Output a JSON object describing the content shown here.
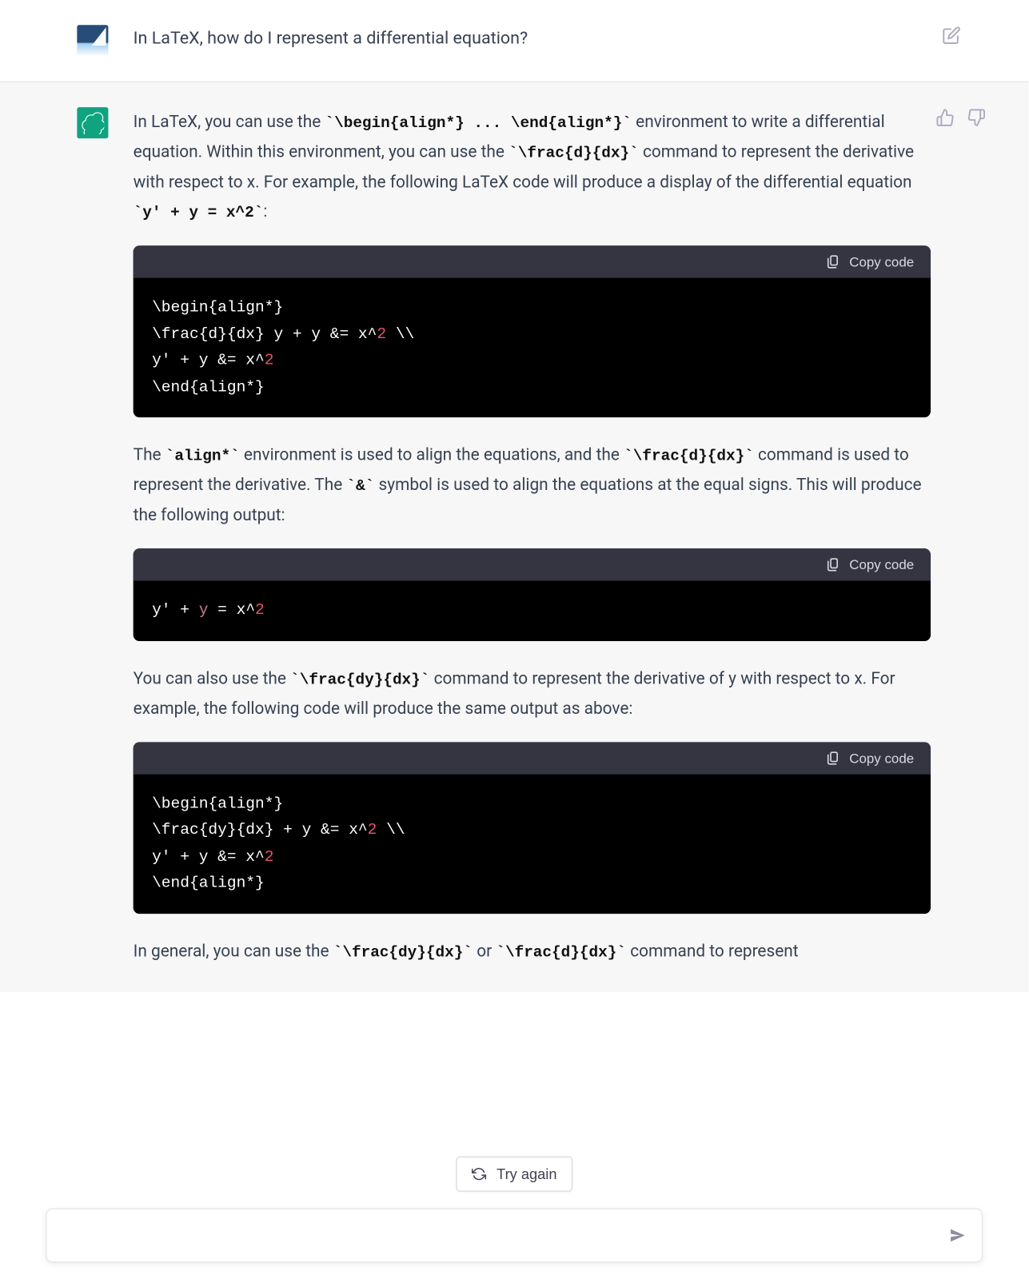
{
  "user": {
    "question": "In LaTeX, how do I represent a differential equation?"
  },
  "assistant": {
    "p1_a": "In LaTeX, you can use the ",
    "p1_code1": "`\\begin{align*} ... \\end{align*}`",
    "p1_b": " environment to write a differential equation. Within this environment, you can use the ",
    "p1_code2": "`\\frac{d}{dx}`",
    "p1_c": " command to represent the derivative with respect to x. For example, the following LaTeX code will produce a display of the differential equation ",
    "p1_code3": "`y' + y = x^2`",
    "p1_d": ":",
    "p2_a": "The ",
    "p2_code1": "`align*`",
    "p2_b": " environment is used to align the equations, and the ",
    "p2_code2": "`\\frac{d}{dx}`",
    "p2_c": " command is used to represent the derivative. The ",
    "p2_code3": "`&`",
    "p2_d": " symbol is used to align the equations at the equal signs. This will produce the following output:",
    "p3_a": "You can also use the ",
    "p3_code1": "`\\frac{dy}{dx}`",
    "p3_b": " command to represent the derivative of y with respect to x. For example, the following code will produce the same output as above:",
    "p4_a": "In general, you can use the ",
    "p4_code1": "`\\frac{dy}{dx}`",
    "p4_b": " or ",
    "p4_code2": "`\\frac{d}{dx}`",
    "p4_c": " command to represent"
  },
  "code": {
    "block1": {
      "l1": "\\begin{align*}",
      "l2a": "\\frac{d}{dx} y + y &= x^",
      "l2num": "2",
      "l2b": " \\\\",
      "l3a": "y' + y &= x^",
      "l3num": "2",
      "l4": "\\end{align*}"
    },
    "block2": {
      "l1a": "y' + ",
      "l1y": "y",
      "l1b": " = x^",
      "l1num": "2"
    },
    "block3": {
      "l1": "\\begin{align*}",
      "l2a": "\\frac{dy}{dx} + y &= x^",
      "l2num": "2",
      "l2b": " \\\\",
      "l3a": "y' + y &= x^",
      "l3num": "2",
      "l4": "\\end{align*}"
    }
  },
  "ui": {
    "copy_label": "Copy code",
    "try_again": "Try again",
    "composer_placeholder": ""
  }
}
